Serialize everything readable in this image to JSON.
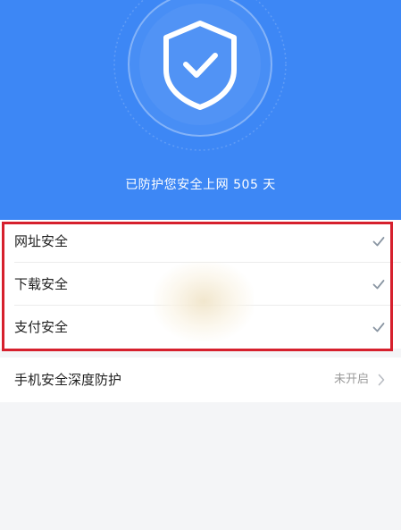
{
  "hero": {
    "protection_text": "已防护您安全上网 505 天",
    "shield_icon": "shield-check-icon",
    "background_color": "#3d87f5"
  },
  "protections": {
    "items": [
      {
        "label": "网址安全",
        "icon": "check-icon",
        "enabled": true
      },
      {
        "label": "下载安全",
        "icon": "check-icon",
        "enabled": true
      },
      {
        "label": "支付安全",
        "icon": "check-icon",
        "enabled": true
      }
    ],
    "highlight_color": "#d6202d"
  },
  "deep_protection": {
    "label": "手机安全深度防护",
    "status": "未开启",
    "icon": "chevron-right-icon"
  }
}
